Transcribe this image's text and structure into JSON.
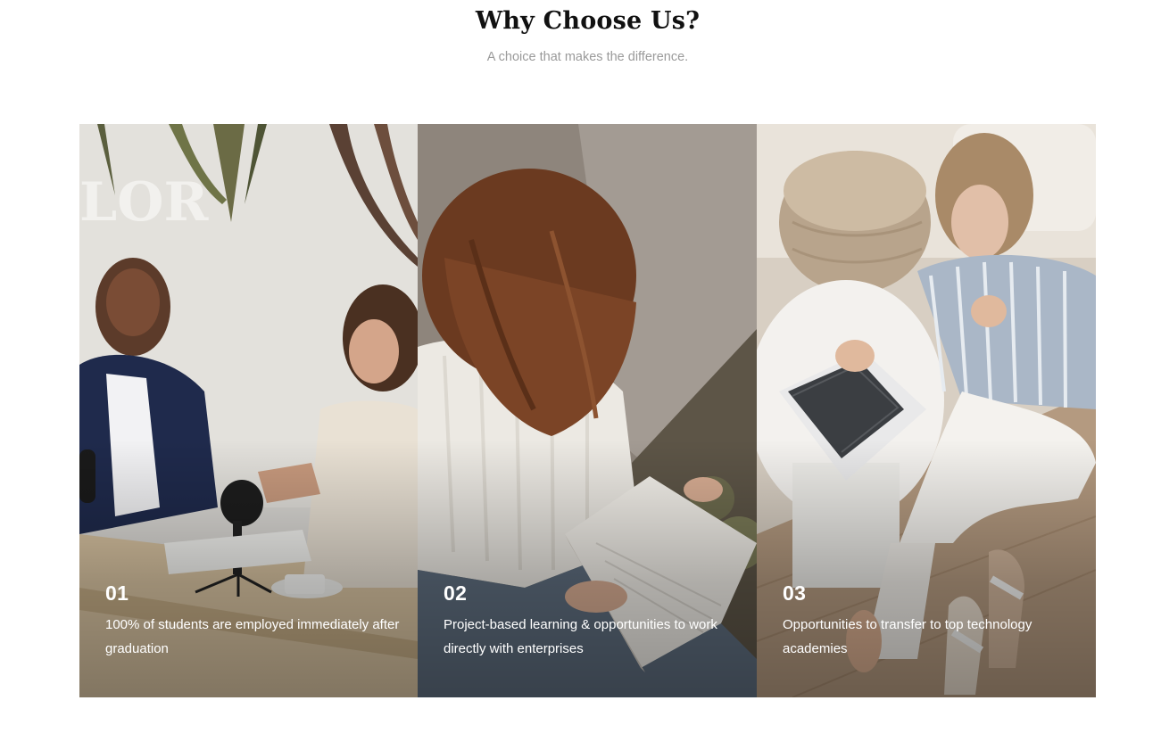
{
  "header": {
    "title": "Why Choose Us?",
    "subtitle": "A choice that makes the difference."
  },
  "cards": [
    {
      "number": "01",
      "text": "100% of students are employed immediately after graduation",
      "image": "handshake-photo"
    },
    {
      "number": "02",
      "text": "Project-based learning & opportunities to work directly with enterprises",
      "image": "reading-book-photo"
    },
    {
      "number": "03",
      "text": "Opportunities to transfer to top technology academies",
      "image": "laptop-photo"
    }
  ],
  "colors": {
    "background": "#ffffff",
    "title": "#111111",
    "subtitle": "#9a9a9a",
    "card_text": "#ffffff"
  }
}
